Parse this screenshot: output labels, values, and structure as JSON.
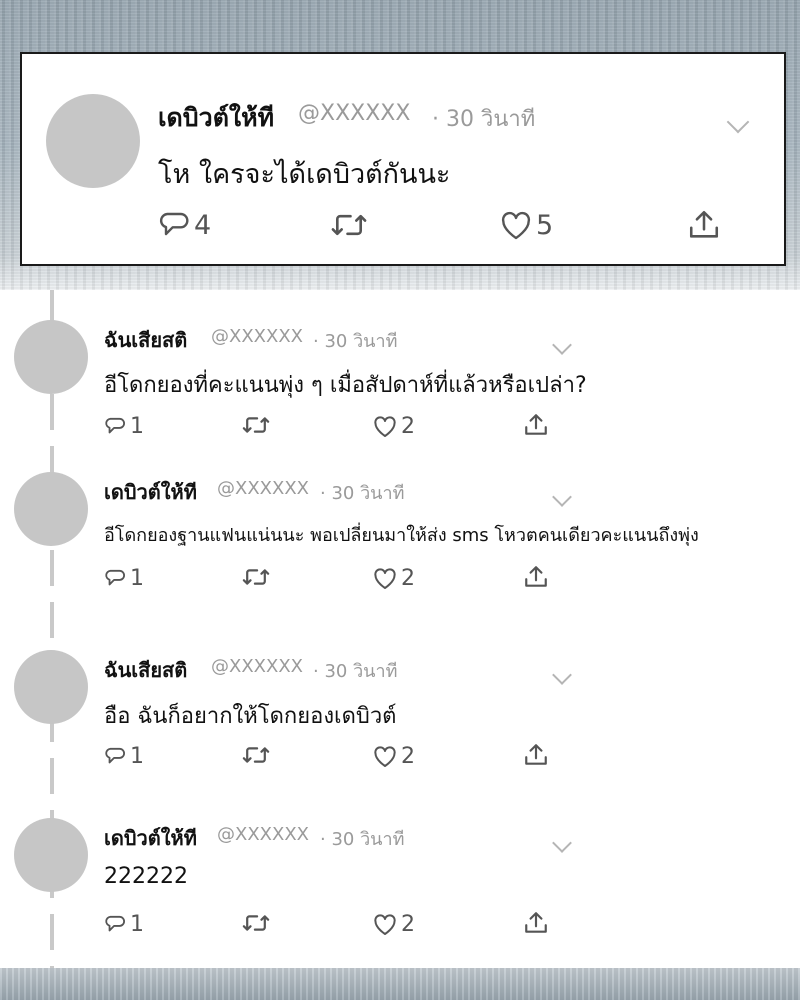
{
  "main_tweet": {
    "name": "เดบิวต์ให้ที",
    "handle": "@XXXXXX",
    "time": "· 30 วินาที",
    "text": "โห ใครจะได้เดบิวต์กันนะ",
    "reply_count": "4",
    "like_count": "5"
  },
  "replies": [
    {
      "name": "ฉันเสียสติ",
      "handle": "@XXXXXX",
      "time": "· 30 วินาที",
      "text": "อีโดกยองที่คะแนนพุ่ง ๆ เมื่อสัปดาห์ที่แล้วหรือเปล่า?",
      "reply_count": "1",
      "like_count": "2"
    },
    {
      "name": "เดบิวต์ให้ที",
      "handle": "@XXXXXX",
      "time": "· 30 วินาที",
      "text": "อีโดกยองฐานแฟนแน่นนะ พอเปลี่ยนมาให้ส่ง sms โหวตคนเดียวคะแนนถึงพุ่ง",
      "reply_count": "1",
      "like_count": "2"
    },
    {
      "name": "ฉันเสียสติ",
      "handle": "@XXXXXX",
      "time": "· 30 วินาที",
      "text": "อือ ฉันก็อยากให้โดกยองเดบิวต์",
      "reply_count": "1",
      "like_count": "2"
    },
    {
      "name": "เดบิวต์ให้ที",
      "handle": "@XXXXXX",
      "time": "· 30 วินาที",
      "text": "222222",
      "reply_count": "1",
      "like_count": "2"
    }
  ],
  "icons": {
    "reply": "speech-bubble-icon",
    "retweet": "retweet-icon",
    "like": "heart-icon",
    "share": "share-icon",
    "menu": "chevron-down-icon"
  },
  "colors": {
    "icon_gray": "#555555",
    "meta_gray": "#9a9a9a",
    "avatar_gray": "#c6c6c6"
  }
}
